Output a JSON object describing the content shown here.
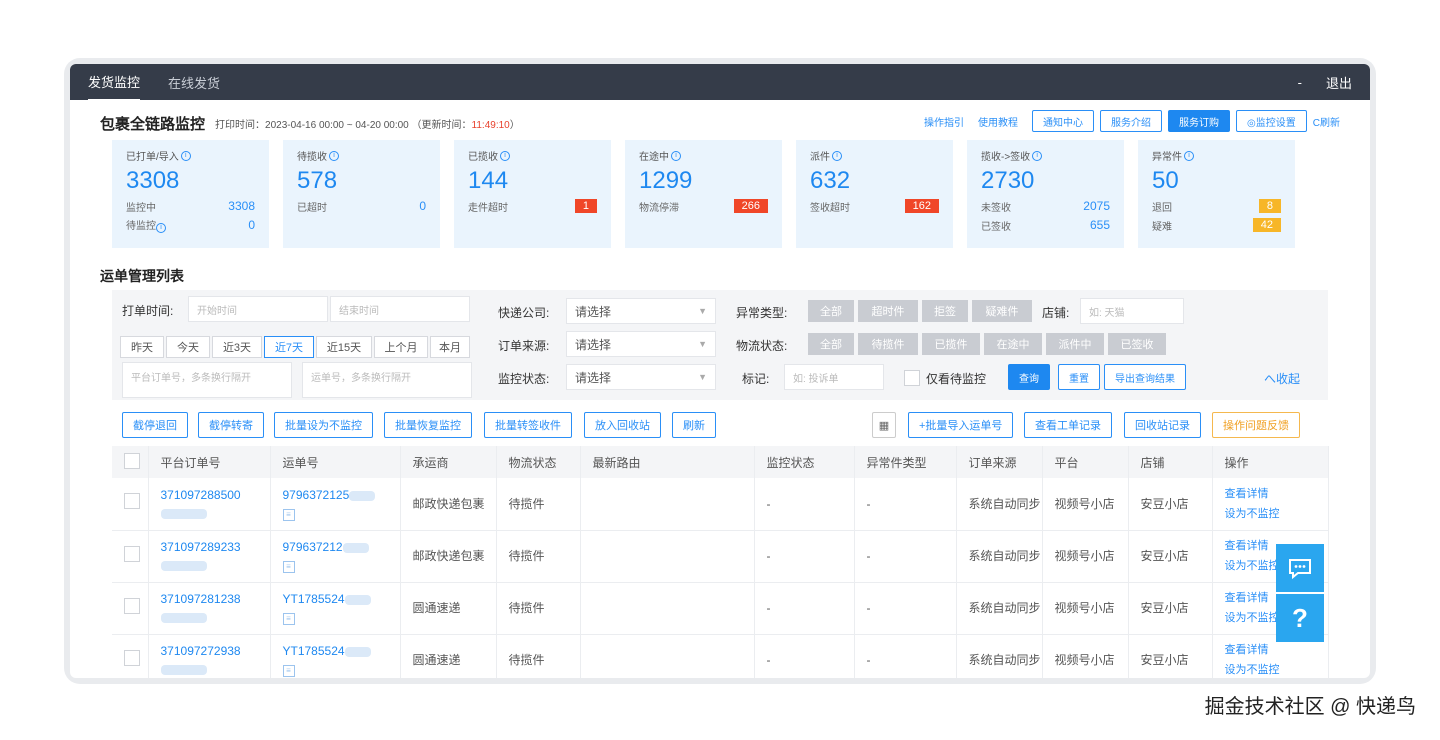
{
  "topbar": {
    "tabs": [
      "发货监控",
      "在线发货"
    ],
    "dash": "-",
    "logout": "退出"
  },
  "header": {
    "title": "包裹全链路监控",
    "print_time_label": "打印时间：2023-04-16 00:00 ~ 04-20 00:00",
    "update_prefix": "（更新时间：",
    "update_time": "11:49:10",
    "update_suffix": "）",
    "links": [
      "操作指引",
      "使用教程"
    ],
    "buttons": [
      "通知中心",
      "服务介绍",
      "服务订购",
      "◎监控设置"
    ],
    "refresh": "C刷新"
  },
  "cards": [
    {
      "label": "已打单/导入",
      "num": "3308",
      "r1l": "监控中",
      "r1v": "3308",
      "r2l": "待监控",
      "r2v": "0"
    },
    {
      "label": "待揽收",
      "num": "578",
      "r1l": "已超时",
      "r1v": "0"
    },
    {
      "label": "已揽收",
      "num": "144",
      "r1l": "走件超时",
      "r1v": "1"
    },
    {
      "label": "在途中",
      "num": "1299",
      "r1l": "物流停滞",
      "r1v": "266"
    },
    {
      "label": "派件",
      "num": "632",
      "r1l": "签收超时",
      "r1v": "162"
    },
    {
      "label": "揽收->签收",
      "num": "2730",
      "r1l": "未签收",
      "r1v": "2075",
      "r2l": "已签收",
      "r2v": "655"
    },
    {
      "label": "异常件",
      "num": "50",
      "r1l": "退回",
      "r1v": "8",
      "r2l": "疑难",
      "r2v": "42"
    }
  ],
  "section_title": "运单管理列表",
  "filters": {
    "print_time_label": "打单时间:",
    "start_ph": "开始时间",
    "end_ph": "结束时间",
    "quick": [
      "昨天",
      "今天",
      "近3天",
      "近7天",
      "近15天",
      "上个月",
      "本月"
    ],
    "order_ph": "平台订单号，多条换行隔开",
    "waybill_ph": "运单号，多条换行隔开",
    "express_label": "快递公司:",
    "source_label": "订单来源:",
    "monitor_label": "监控状态:",
    "select_ph": "请选择",
    "abnormal_label": "异常类型:",
    "abnormal_chips": [
      "全部",
      "超时件",
      "拒签",
      "疑难件"
    ],
    "shop_label": "店铺:",
    "shop_ph": "如: 天猫",
    "logistics_label": "物流状态:",
    "logistics_chips": [
      "全部",
      "待揽件",
      "已揽件",
      "在途中",
      "派件中",
      "已签收"
    ],
    "mark_label": "标记:",
    "mark_ph": "如: 投诉单",
    "only_pending": "仅看待监控",
    "query": "查询",
    "reset": "重置",
    "export": "导出查询结果",
    "collapse": "へ收起"
  },
  "toolbar": {
    "left": [
      "截停退回",
      "截停转寄",
      "批量设为不监控",
      "批量恢复监控",
      "批量转签收件",
      "放入回收站",
      "刷新"
    ],
    "right": [
      "+批量导入运单号",
      "查看工单记录",
      "回收站记录",
      "操作问题反馈"
    ]
  },
  "table": {
    "headers": [
      "平台订单号",
      "运单号",
      "承运商",
      "物流状态",
      "最新路由",
      "监控状态",
      "异常件类型",
      "订单来源",
      "平台",
      "店铺",
      "操作"
    ],
    "rows": [
      {
        "order": "371097288500",
        "waybill": "9796372125",
        "carrier": "邮政快递包裹",
        "status": "待揽件",
        "route": "",
        "monitor": "-",
        "abnormal": "-",
        "source": "系统自动同步",
        "platform": "视频号小店",
        "shop": "安豆小店"
      },
      {
        "order": "371097289233",
        "waybill": "979637212",
        "carrier": "邮政快递包裹",
        "status": "待揽件",
        "route": "",
        "monitor": "-",
        "abnormal": "-",
        "source": "系统自动同步",
        "platform": "视频号小店",
        "shop": "安豆小店"
      },
      {
        "order": "371097281238",
        "waybill": "YT1785524",
        "carrier": "圆通速递",
        "status": "待揽件",
        "route": "",
        "monitor": "-",
        "abnormal": "-",
        "source": "系统自动同步",
        "platform": "视频号小店",
        "shop": "安豆小店"
      },
      {
        "order": "371097272938",
        "waybill": "YT1785524",
        "carrier": "圆通速递",
        "status": "待揽件",
        "route": "",
        "monitor": "-",
        "abnormal": "-",
        "source": "系统自动同步",
        "platform": "视频号小店",
        "shop": "安豆小店"
      }
    ],
    "ops": [
      "查看详情",
      "设为不监控"
    ]
  },
  "watermark": "掘金技术社区 @ 快递鸟"
}
